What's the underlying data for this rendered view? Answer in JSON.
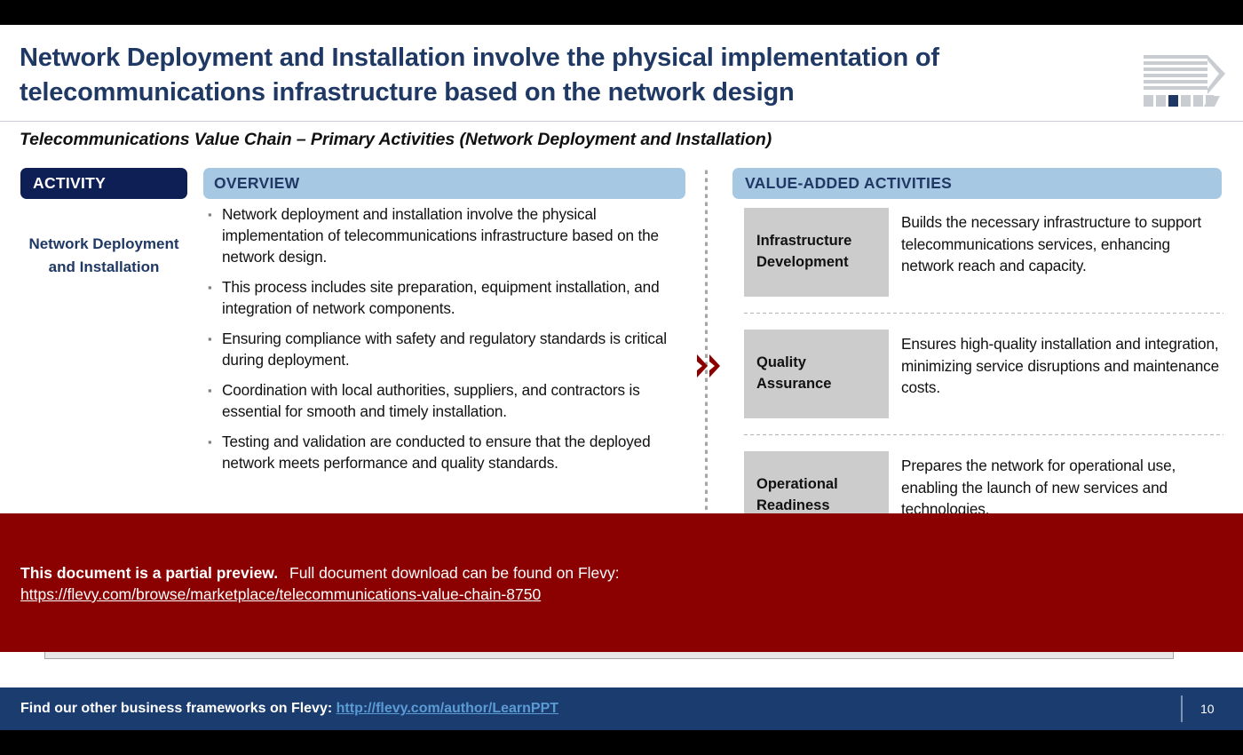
{
  "header": {
    "title": "Network Deployment and Installation involve the physical implementation of telecommunications infrastructure based on the network design",
    "subtitle": "Telecommunications Value Chain – Primary Activities (Network Deployment and Installation)",
    "logo_name": "striped-chevron-logo"
  },
  "columns": {
    "activity_header": "ACTIVITY",
    "overview_header": "OVERVIEW",
    "value_added_header": "VALUE-ADDED ACTIVITIES"
  },
  "activity": {
    "name": "Network Deployment and Installation"
  },
  "overview": {
    "bullet_marker": "▪",
    "bullets": [
      "Network deployment and installation involve the physical implementation of telecommunications infrastructure based on the network design.",
      "This process includes site preparation, equipment installation, and integration of network components.",
      "Ensuring compliance with safety and regulatory standards is critical during deployment.",
      "Coordination with local authorities, suppliers, and contractors is essential for smooth and timely installation.",
      "Testing and validation are conducted to ensure that the deployed network meets performance and quality standards."
    ]
  },
  "divider": {
    "chevron_glyph": "»"
  },
  "value_added_activities": [
    {
      "tag": "Infrastructure Development",
      "description": "Builds the necessary infrastructure to support telecommunications services, enhancing network reach and capacity."
    },
    {
      "tag": "Quality Assurance",
      "description": "Ensures high-quality installation and integration, minimizing service disruptions and maintenance costs."
    },
    {
      "tag": "Operational Readiness",
      "description": "Prepares the network for operational use, enabling the launch of new services and technologies."
    }
  ],
  "preview_banner": {
    "bold_text": "This document is a partial preview.",
    "rest_text": "Full document download can be found on Flevy:",
    "url": "https://flevy.com/browse/marketplace/telecommunications-value-chain-8750",
    "color": "#8B0000"
  },
  "footer": {
    "text": "Find our other business frameworks on Flevy:",
    "link": "http://flevy.com/author/LearnPPT",
    "page_number": "10",
    "background": "#1B3C6E",
    "link_color": "#5B9BD5"
  },
  "theme": {
    "dark_navy": "#0E1F56",
    "title_blue": "#1F3864",
    "header_blue": "#A7C8E3",
    "tag_gray": "#CCCCCC"
  }
}
